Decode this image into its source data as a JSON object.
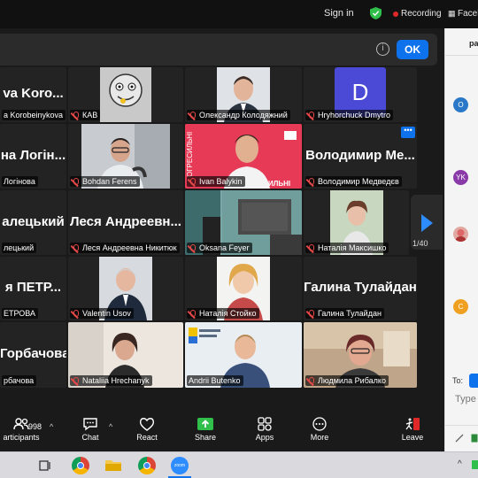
{
  "topbar": {
    "signin": "Sign in",
    "recording": "Recording",
    "facebook": "Faceb"
  },
  "notice": {
    "ok_label": "OK",
    "info_icon": "info-icon"
  },
  "tiles": {
    "r1c1": {
      "big": "va  Koro...",
      "label": "a Korobeinykova"
    },
    "r1c2": {
      "label": "КАВ"
    },
    "r1c3": {
      "label": "Олександр Колодяжний"
    },
    "r1c4": {
      "label": "Hryhorchuck Dmytro",
      "avatar_letter": "D"
    },
    "r2c1": {
      "big": "на  Логін...",
      "label": "Логінова"
    },
    "r2c2": {
      "label": "Bohdan Ferens"
    },
    "r2c3": {
      "label": "Ivan Balykin"
    },
    "r2c4": {
      "big": "Володимир  Ме...",
      "label": "Володимир Медведєв"
    },
    "r3c1": {
      "big": "алецький",
      "label": "лецький"
    },
    "r3c2": {
      "big": "Леся  Андреевн...",
      "label": "Леся Андреевна Никитюк"
    },
    "r3c3": {
      "label": "Oksana Feyer"
    },
    "r3c4": {
      "label": "Наталія Максишко"
    },
    "r4c1": {
      "big": "я  ПЕТР...",
      "label": "ЕТРОВА"
    },
    "r4c2": {
      "label": "Valentin Usov"
    },
    "r4c3": {
      "label": "Наталія Стойко"
    },
    "r4c4": {
      "big": "Галина  Тулайдан",
      "label": "Галина Тулайдан"
    },
    "r5c1": {
      "big": "Горбачова",
      "label": "рбачова"
    },
    "r5c2": {
      "label": "Nataliia Hrechanyk"
    },
    "r5c3": {
      "label": "Andrii Butenko"
    },
    "r5c4": {
      "label": "Людмила Рибалко"
    }
  },
  "pagination": {
    "page": "1/40"
  },
  "toolbar": {
    "participants_count": "998",
    "participants": "articipants",
    "chat": "Chat",
    "react": "React",
    "share": "Share",
    "apps": "Apps",
    "more": "More",
    "leave": "Leave"
  },
  "side_panel": {
    "avatars": [
      "O",
      "YK",
      "C"
    ],
    "to_label": "To:",
    "type_placeholder": "Type",
    "header": "pa"
  },
  "colors": {
    "accent": "#0e72ed",
    "speaker": "#2fd34a",
    "muted": "#e54848"
  }
}
